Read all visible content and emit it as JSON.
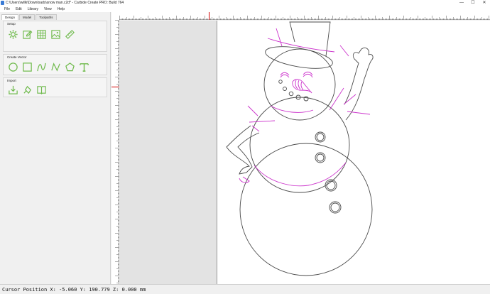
{
  "window": {
    "title": "C:\\Users\\willk\\Downloads\\snow man.c2d* - Carbide Create PRO: Build 764",
    "minimize": "—",
    "maximize": "☐",
    "close": "✕"
  },
  "menu": [
    "File",
    "Edit",
    "Library",
    "View",
    "Help"
  ],
  "tabs": [
    "Design",
    "Model",
    "Toolpaths"
  ],
  "sections": {
    "setup": {
      "title": "Setup",
      "tools": [
        "settings-gear-icon",
        "edit-icon",
        "grid-icon",
        "image-icon",
        "ruler-icon"
      ]
    },
    "create_vector": {
      "title": "Create Vector",
      "tools": [
        "circle-icon",
        "rectangle-icon",
        "curve-icon",
        "polyline-icon",
        "polygon-icon",
        "text-icon"
      ]
    },
    "import": {
      "title": "Import",
      "tools": [
        "import-icon",
        "bitmap-trace-icon",
        "book-icon"
      ]
    }
  },
  "colors": {
    "accent_green": "#6fba4c",
    "vector_dark": "#4a4a4a",
    "vector_selected": "#cc33cc",
    "ruler_marker": "#d00000"
  },
  "status": {
    "cursor_position": "Cursor Position X: -5.060 Y: 190.779 Z: 0.000 mm"
  }
}
